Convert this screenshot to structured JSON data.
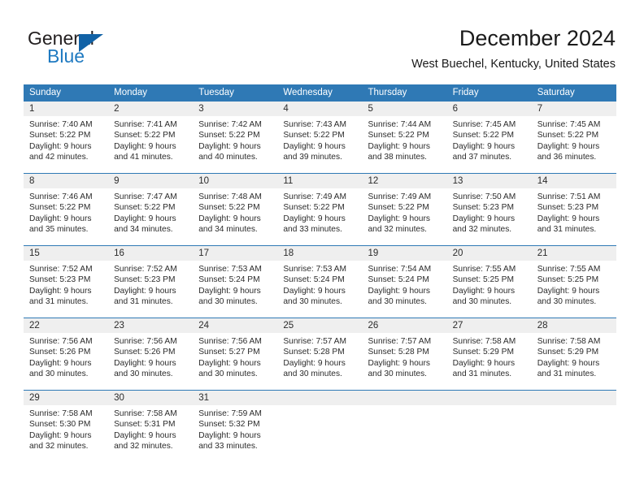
{
  "logo": {
    "word_top": "General",
    "word_bottom": "Blue",
    "triangle_color": "#1162a6",
    "blue_text_color": "#1f7ac1"
  },
  "header": {
    "title": "December 2024",
    "subtitle": "West Buechel, Kentucky, United States"
  },
  "theme": {
    "header_blue": "#2f79b5",
    "day_band_gray": "#efefef",
    "text_color": "#2b2b2b"
  },
  "weekday_headers": [
    "Sunday",
    "Monday",
    "Tuesday",
    "Wednesday",
    "Thursday",
    "Friday",
    "Saturday"
  ],
  "weeks": [
    [
      {
        "day": "1",
        "sunrise": "Sunrise: 7:40 AM",
        "sunset": "Sunset: 5:22 PM",
        "daylight1": "Daylight: 9 hours",
        "daylight2": "and 42 minutes."
      },
      {
        "day": "2",
        "sunrise": "Sunrise: 7:41 AM",
        "sunset": "Sunset: 5:22 PM",
        "daylight1": "Daylight: 9 hours",
        "daylight2": "and 41 minutes."
      },
      {
        "day": "3",
        "sunrise": "Sunrise: 7:42 AM",
        "sunset": "Sunset: 5:22 PM",
        "daylight1": "Daylight: 9 hours",
        "daylight2": "and 40 minutes."
      },
      {
        "day": "4",
        "sunrise": "Sunrise: 7:43 AM",
        "sunset": "Sunset: 5:22 PM",
        "daylight1": "Daylight: 9 hours",
        "daylight2": "and 39 minutes."
      },
      {
        "day": "5",
        "sunrise": "Sunrise: 7:44 AM",
        "sunset": "Sunset: 5:22 PM",
        "daylight1": "Daylight: 9 hours",
        "daylight2": "and 38 minutes."
      },
      {
        "day": "6",
        "sunrise": "Sunrise: 7:45 AM",
        "sunset": "Sunset: 5:22 PM",
        "daylight1": "Daylight: 9 hours",
        "daylight2": "and 37 minutes."
      },
      {
        "day": "7",
        "sunrise": "Sunrise: 7:45 AM",
        "sunset": "Sunset: 5:22 PM",
        "daylight1": "Daylight: 9 hours",
        "daylight2": "and 36 minutes."
      }
    ],
    [
      {
        "day": "8",
        "sunrise": "Sunrise: 7:46 AM",
        "sunset": "Sunset: 5:22 PM",
        "daylight1": "Daylight: 9 hours",
        "daylight2": "and 35 minutes."
      },
      {
        "day": "9",
        "sunrise": "Sunrise: 7:47 AM",
        "sunset": "Sunset: 5:22 PM",
        "daylight1": "Daylight: 9 hours",
        "daylight2": "and 34 minutes."
      },
      {
        "day": "10",
        "sunrise": "Sunrise: 7:48 AM",
        "sunset": "Sunset: 5:22 PM",
        "daylight1": "Daylight: 9 hours",
        "daylight2": "and 34 minutes."
      },
      {
        "day": "11",
        "sunrise": "Sunrise: 7:49 AM",
        "sunset": "Sunset: 5:22 PM",
        "daylight1": "Daylight: 9 hours",
        "daylight2": "and 33 minutes."
      },
      {
        "day": "12",
        "sunrise": "Sunrise: 7:49 AM",
        "sunset": "Sunset: 5:22 PM",
        "daylight1": "Daylight: 9 hours",
        "daylight2": "and 32 minutes."
      },
      {
        "day": "13",
        "sunrise": "Sunrise: 7:50 AM",
        "sunset": "Sunset: 5:23 PM",
        "daylight1": "Daylight: 9 hours",
        "daylight2": "and 32 minutes."
      },
      {
        "day": "14",
        "sunrise": "Sunrise: 7:51 AM",
        "sunset": "Sunset: 5:23 PM",
        "daylight1": "Daylight: 9 hours",
        "daylight2": "and 31 minutes."
      }
    ],
    [
      {
        "day": "15",
        "sunrise": "Sunrise: 7:52 AM",
        "sunset": "Sunset: 5:23 PM",
        "daylight1": "Daylight: 9 hours",
        "daylight2": "and 31 minutes."
      },
      {
        "day": "16",
        "sunrise": "Sunrise: 7:52 AM",
        "sunset": "Sunset: 5:23 PM",
        "daylight1": "Daylight: 9 hours",
        "daylight2": "and 31 minutes."
      },
      {
        "day": "17",
        "sunrise": "Sunrise: 7:53 AM",
        "sunset": "Sunset: 5:24 PM",
        "daylight1": "Daylight: 9 hours",
        "daylight2": "and 30 minutes."
      },
      {
        "day": "18",
        "sunrise": "Sunrise: 7:53 AM",
        "sunset": "Sunset: 5:24 PM",
        "daylight1": "Daylight: 9 hours",
        "daylight2": "and 30 minutes."
      },
      {
        "day": "19",
        "sunrise": "Sunrise: 7:54 AM",
        "sunset": "Sunset: 5:24 PM",
        "daylight1": "Daylight: 9 hours",
        "daylight2": "and 30 minutes."
      },
      {
        "day": "20",
        "sunrise": "Sunrise: 7:55 AM",
        "sunset": "Sunset: 5:25 PM",
        "daylight1": "Daylight: 9 hours",
        "daylight2": "and 30 minutes."
      },
      {
        "day": "21",
        "sunrise": "Sunrise: 7:55 AM",
        "sunset": "Sunset: 5:25 PM",
        "daylight1": "Daylight: 9 hours",
        "daylight2": "and 30 minutes."
      }
    ],
    [
      {
        "day": "22",
        "sunrise": "Sunrise: 7:56 AM",
        "sunset": "Sunset: 5:26 PM",
        "daylight1": "Daylight: 9 hours",
        "daylight2": "and 30 minutes."
      },
      {
        "day": "23",
        "sunrise": "Sunrise: 7:56 AM",
        "sunset": "Sunset: 5:26 PM",
        "daylight1": "Daylight: 9 hours",
        "daylight2": "and 30 minutes."
      },
      {
        "day": "24",
        "sunrise": "Sunrise: 7:56 AM",
        "sunset": "Sunset: 5:27 PM",
        "daylight1": "Daylight: 9 hours",
        "daylight2": "and 30 minutes."
      },
      {
        "day": "25",
        "sunrise": "Sunrise: 7:57 AM",
        "sunset": "Sunset: 5:28 PM",
        "daylight1": "Daylight: 9 hours",
        "daylight2": "and 30 minutes."
      },
      {
        "day": "26",
        "sunrise": "Sunrise: 7:57 AM",
        "sunset": "Sunset: 5:28 PM",
        "daylight1": "Daylight: 9 hours",
        "daylight2": "and 30 minutes."
      },
      {
        "day": "27",
        "sunrise": "Sunrise: 7:58 AM",
        "sunset": "Sunset: 5:29 PM",
        "daylight1": "Daylight: 9 hours",
        "daylight2": "and 31 minutes."
      },
      {
        "day": "28",
        "sunrise": "Sunrise: 7:58 AM",
        "sunset": "Sunset: 5:29 PM",
        "daylight1": "Daylight: 9 hours",
        "daylight2": "and 31 minutes."
      }
    ],
    [
      {
        "day": "29",
        "sunrise": "Sunrise: 7:58 AM",
        "sunset": "Sunset: 5:30 PM",
        "daylight1": "Daylight: 9 hours",
        "daylight2": "and 32 minutes."
      },
      {
        "day": "30",
        "sunrise": "Sunrise: 7:58 AM",
        "sunset": "Sunset: 5:31 PM",
        "daylight1": "Daylight: 9 hours",
        "daylight2": "and 32 minutes."
      },
      {
        "day": "31",
        "sunrise": "Sunrise: 7:59 AM",
        "sunset": "Sunset: 5:32 PM",
        "daylight1": "Daylight: 9 hours",
        "daylight2": "and 33 minutes."
      },
      {
        "day": "",
        "sunrise": "",
        "sunset": "",
        "daylight1": "",
        "daylight2": ""
      },
      {
        "day": "",
        "sunrise": "",
        "sunset": "",
        "daylight1": "",
        "daylight2": ""
      },
      {
        "day": "",
        "sunrise": "",
        "sunset": "",
        "daylight1": "",
        "daylight2": ""
      },
      {
        "day": "",
        "sunrise": "",
        "sunset": "",
        "daylight1": "",
        "daylight2": ""
      }
    ]
  ]
}
